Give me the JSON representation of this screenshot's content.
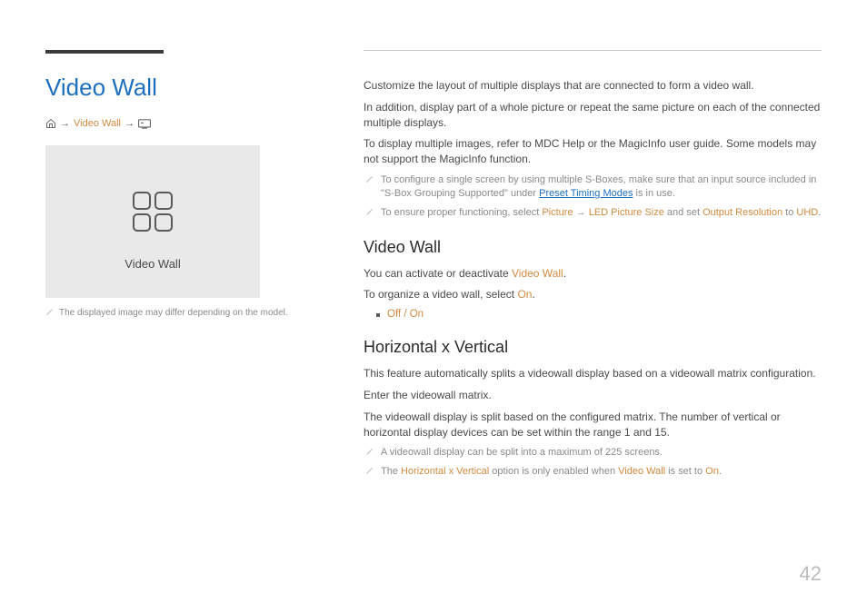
{
  "page_number": "42",
  "left": {
    "title": "Video Wall",
    "breadcrumb_item": "Video Wall",
    "mock_label": "Video Wall",
    "note": "The displayed image may differ depending on the model."
  },
  "right": {
    "intro": [
      "Customize the layout of multiple displays that are connected to form a video wall.",
      "In addition, display part of a whole picture or repeat the same picture on each of the connected multiple displays.",
      "To display multiple images, refer to MDC Help or the MagicInfo user guide. Some models may not support the MagicInfo function."
    ],
    "intro_notes": {
      "n1_a": "To configure a single screen by using multiple S-Boxes, make sure that an input source included in \"S-Box Grouping Supported\" under ",
      "n1_link": "Preset Timing Modes",
      "n1_b": " is in use.",
      "n2_a": "To ensure proper functioning, select ",
      "n2_t1": "Picture",
      "n2_b": " → ",
      "n2_t2": "LED Picture Size",
      "n2_c": " and set ",
      "n2_t3": "Output Resolution",
      "n2_d": " to ",
      "n2_t4": "UHD",
      "n2_e": "."
    },
    "sec_vw": {
      "h": "Video Wall",
      "p1_a": "You can activate or deactivate ",
      "p1_t": "Video Wall",
      "p1_b": ".",
      "p2_a": "To organize a video wall, select ",
      "p2_t": "On",
      "p2_b": ".",
      "bullet": "Off / On"
    },
    "sec_hv": {
      "h": "Horizontal x Vertical",
      "p1": "This feature automatically splits a videowall display based on a videowall matrix configuration.",
      "p2": "Enter the videowall matrix.",
      "p3": "The videowall display is split based on the configured matrix. The number of vertical or horizontal display devices can be set within the range 1 and 15.",
      "n1": "A videowall display can be split into a maximum of 225 screens.",
      "n2_a": "The ",
      "n2_t1": "Horizontal x Vertical",
      "n2_b": " option is only enabled when ",
      "n2_t2": "Video Wall",
      "n2_c": " is set to ",
      "n2_t3": "On",
      "n2_d": "."
    }
  }
}
